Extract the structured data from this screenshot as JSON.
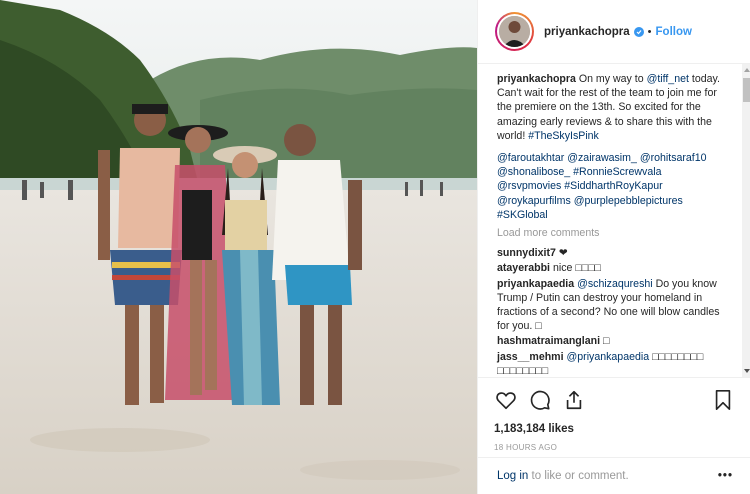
{
  "post": {
    "username": "priyankachopra",
    "follow_label": "Follow",
    "separator": "•",
    "caption": {
      "text": "On my way to ",
      "tag1": "@tiff_net",
      "text2": " today. Can't wait for the rest of the team to join me for the premiere on the 13th. So excited for the amazing early reviews & to share this with the world! ",
      "hashtag": "#TheSkyIsPink"
    },
    "mentions": [
      "@faroutakhtar",
      "@zairawasim_",
      "@rohitsaraf10",
      "@shonalibose_",
      "#RonnieScrewvala",
      "@rsvpmovies",
      "#SiddharthRoyKapur",
      "@roykapurfilms",
      "@purplepebblepictures",
      "#SKGlobal"
    ],
    "load_more": "Load more comments",
    "comments": [
      {
        "user": "sunnydixit7",
        "text": "❤"
      },
      {
        "user": "atayerabbi",
        "text": "nice □□□□"
      },
      {
        "user": "priyankapaedia",
        "mention": "@schizaqureshi",
        "text": " Do you know Trump / Putin can destroy your homeland in fractions of a second? No one will blow candles for you. □"
      },
      {
        "user": "hashmatraimanglani",
        "text": "□"
      },
      {
        "user": "jass__mehmi",
        "mention": "@priyankapaedia",
        "text": " □□□□□□□□ □□□□□□□□"
      }
    ],
    "likes": "1,183,184 likes",
    "timestamp": "18 HOURS AGO",
    "footer": {
      "login": "Log in",
      "login_suffix": " to like or comment.",
      "more": "•••"
    }
  },
  "colors": {
    "accent": "#3897f0",
    "link": "#003569",
    "muted": "#999999"
  },
  "icons": [
    "heart-icon",
    "comment-icon",
    "share-icon",
    "bookmark-icon",
    "verified-icon"
  ]
}
